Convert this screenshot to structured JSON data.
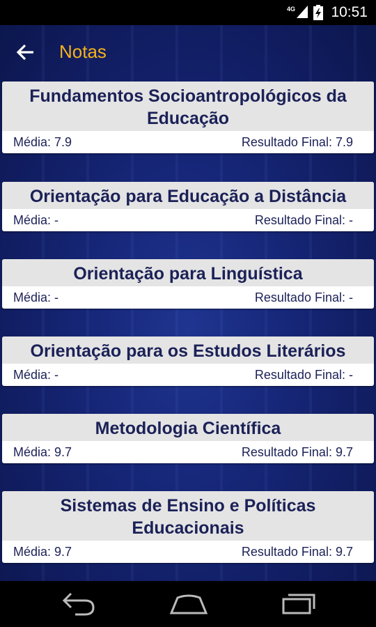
{
  "status_bar": {
    "time": "10:51",
    "network": "4G",
    "icons": [
      "signal-icon",
      "battery-charging-icon"
    ]
  },
  "app_bar": {
    "title": "Notas",
    "back_icon": "arrow-back-icon"
  },
  "grades": [
    {
      "subject": "Fundamentos Socioantropológicos da Educação",
      "media_label": "Média:",
      "media": "7.9",
      "final_label": "Resultado Final:",
      "final": "7.9"
    },
    {
      "subject": "Orientação para Educação a Distância",
      "media_label": "Média:",
      "media": "-",
      "final_label": "Resultado Final:",
      "final": "-"
    },
    {
      "subject": "Orientação para Linguística",
      "media_label": "Média:",
      "media": "-",
      "final_label": "Resultado Final:",
      "final": "-"
    },
    {
      "subject": "Orientação para os Estudos Literários",
      "media_label": "Média:",
      "media": "-",
      "final_label": "Resultado Final:",
      "final": "-"
    },
    {
      "subject": "Metodologia Científica",
      "media_label": "Média:",
      "media": "9.7",
      "final_label": "Resultado Final:",
      "final": "9.7"
    },
    {
      "subject": "Sistemas de Ensino e Políticas Educacionais",
      "media_label": "Média:",
      "media": "9.7",
      "final_label": "Resultado Final:",
      "final": "9.7"
    }
  ],
  "nav_bar": {
    "buttons": [
      "back-nav-icon",
      "home-nav-icon",
      "recent-apps-icon"
    ]
  },
  "colors": {
    "accent": "#f5b21b",
    "text_dark": "#1b2157",
    "background": "#17277a",
    "card_header": "#e4e4e4"
  }
}
